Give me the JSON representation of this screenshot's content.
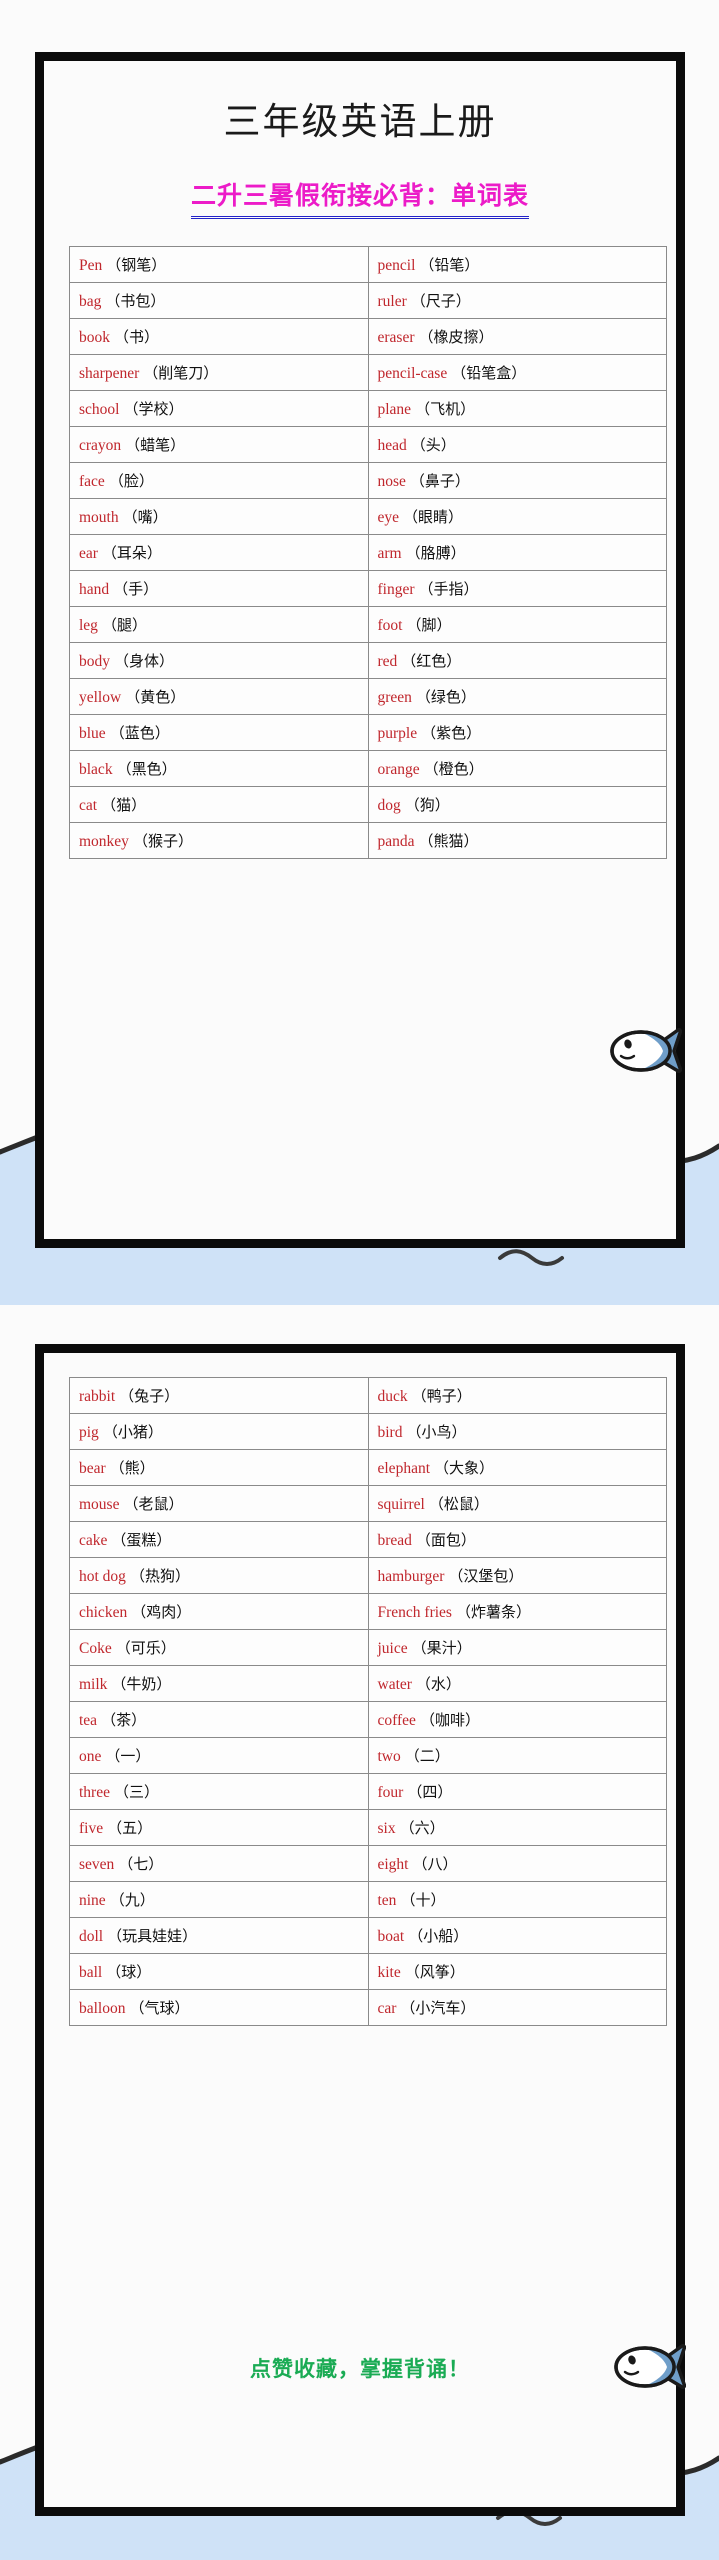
{
  "page": {
    "background_color": "#fbfbfb",
    "water_color": "#cfe2f7",
    "border_color": "#0b0b0b"
  },
  "header": {
    "title": "三年级英语上册",
    "subtitle": "二升三暑假衔接必背：单词表",
    "title_color": "#1a1a1a",
    "subtitle_color": "#ec1bc8",
    "subtitle_underline_color": "#2323c8"
  },
  "word_list_colors": {
    "english": "#c0272d",
    "chinese": "#111111"
  },
  "section_1": {
    "rows": [
      {
        "left": {
          "en": "Pen",
          "zh": "（钢笔）"
        },
        "right": {
          "en": "pencil",
          "zh": "（铅笔）"
        }
      },
      {
        "left": {
          "en": "bag",
          "zh": "（书包）"
        },
        "right": {
          "en": "ruler",
          "zh": "（尺子）"
        }
      },
      {
        "left": {
          "en": "book",
          "zh": "（书）"
        },
        "right": {
          "en": "eraser",
          "zh": "（橡皮擦）"
        }
      },
      {
        "left": {
          "en": "sharpener",
          "zh": "（削笔刀）"
        },
        "right": {
          "en": "pencil-case",
          "zh": "（铅笔盒）"
        }
      },
      {
        "left": {
          "en": "school",
          "zh": "（学校）"
        },
        "right": {
          "en": "plane",
          "zh": "（飞机）"
        }
      },
      {
        "left": {
          "en": "crayon",
          "zh": "（蜡笔）"
        },
        "right": {
          "en": "head",
          "zh": "（头）"
        }
      },
      {
        "left": {
          "en": "face",
          "zh": "（脸）"
        },
        "right": {
          "en": "nose",
          "zh": "（鼻子）"
        }
      },
      {
        "left": {
          "en": "mouth",
          "zh": "（嘴）"
        },
        "right": {
          "en": "eye",
          "zh": "（眼睛）"
        }
      },
      {
        "left": {
          "en": "ear",
          "zh": "（耳朵）"
        },
        "right": {
          "en": "arm",
          "zh": "（胳膊）"
        }
      },
      {
        "left": {
          "en": "hand",
          "zh": "（手）"
        },
        "right": {
          "en": "finger",
          "zh": "（手指）"
        }
      },
      {
        "left": {
          "en": "leg",
          "zh": "（腿）"
        },
        "right": {
          "en": "foot",
          "zh": "（脚）"
        }
      },
      {
        "left": {
          "en": "body",
          "zh": "（身体）"
        },
        "right": {
          "en": "red",
          "zh": "（红色）"
        }
      },
      {
        "left": {
          "en": "yellow",
          "zh": "（黄色）"
        },
        "right": {
          "en": "green",
          "zh": "（绿色）"
        }
      },
      {
        "left": {
          "en": "blue",
          "zh": "（蓝色）"
        },
        "right": {
          "en": "purple",
          "zh": "（紫色）"
        }
      },
      {
        "left": {
          "en": "black",
          "zh": "（黑色）"
        },
        "right": {
          "en": "orange",
          "zh": "（橙色）"
        }
      },
      {
        "left": {
          "en": "cat",
          "zh": "（猫）"
        },
        "right": {
          "en": "dog",
          "zh": "（狗）"
        }
      },
      {
        "left": {
          "en": "monkey",
          "zh": "（猴子）"
        },
        "right": {
          "en": "panda",
          "zh": "（熊猫）"
        }
      }
    ]
  },
  "section_2": {
    "rows": [
      {
        "left": {
          "en": "rabbit",
          "zh": "（兔子）"
        },
        "right": {
          "en": "duck",
          "zh": "（鸭子）"
        }
      },
      {
        "left": {
          "en": "pig",
          "zh": "（小猪）"
        },
        "right": {
          "en": "bird",
          "zh": "（小鸟）"
        }
      },
      {
        "left": {
          "en": "bear",
          "zh": "（熊）"
        },
        "right": {
          "en": "elephant",
          "zh": "（大象）"
        }
      },
      {
        "left": {
          "en": "mouse",
          "zh": "（老鼠）"
        },
        "right": {
          "en": "squirrel",
          "zh": "（松鼠）"
        }
      },
      {
        "left": {
          "en": "cake",
          "zh": "（蛋糕）"
        },
        "right": {
          "en": "bread",
          "zh": "（面包）"
        }
      },
      {
        "left": {
          "en": "hot dog",
          "zh": "（热狗）"
        },
        "right": {
          "en": "hamburger",
          "zh": "（汉堡包）"
        }
      },
      {
        "left": {
          "en": "chicken",
          "zh": "（鸡肉）"
        },
        "right": {
          "en": "French fries",
          "zh": "（炸薯条）"
        }
      },
      {
        "left": {
          "en": "Coke",
          "zh": "（可乐）"
        },
        "right": {
          "en": "juice",
          "zh": "（果汁）"
        }
      },
      {
        "left": {
          "en": "milk",
          "zh": "（牛奶）"
        },
        "right": {
          "en": "water",
          "zh": "（水）"
        }
      },
      {
        "left": {
          "en": "tea",
          "zh": "（茶）"
        },
        "right": {
          "en": "coffee",
          "zh": "（咖啡）"
        }
      },
      {
        "left": {
          "en": "one",
          "zh": "（一）"
        },
        "right": {
          "en": "two",
          "zh": "（二）"
        }
      },
      {
        "left": {
          "en": "three",
          "zh": "（三）"
        },
        "right": {
          "en": "four",
          "zh": "（四）"
        }
      },
      {
        "left": {
          "en": "five",
          "zh": "（五）"
        },
        "right": {
          "en": "six",
          "zh": "（六）"
        }
      },
      {
        "left": {
          "en": "seven",
          "zh": "（七）"
        },
        "right": {
          "en": "eight",
          "zh": "（八）"
        }
      },
      {
        "left": {
          "en": "nine",
          "zh": "（九）"
        },
        "right": {
          "en": "ten",
          "zh": "（十）"
        }
      },
      {
        "left": {
          "en": "doll",
          "zh": "（玩具娃娃）"
        },
        "right": {
          "en": "boat",
          "zh": "（小船）"
        }
      },
      {
        "left": {
          "en": "ball",
          "zh": "（球）"
        },
        "right": {
          "en": "kite",
          "zh": "（风筝）"
        }
      },
      {
        "left": {
          "en": "balloon",
          "zh": "（气球）"
        },
        "right": {
          "en": "car",
          "zh": "（小汽车）"
        }
      }
    ],
    "footer_note": "点赞收藏，掌握背诵！",
    "footer_note_color": "#1aab54"
  },
  "decorations": {
    "fish_body_color": "#6f9ec9",
    "fish_outline_color": "#1a1a1a",
    "wave_line_color": "#2b2b2b"
  }
}
